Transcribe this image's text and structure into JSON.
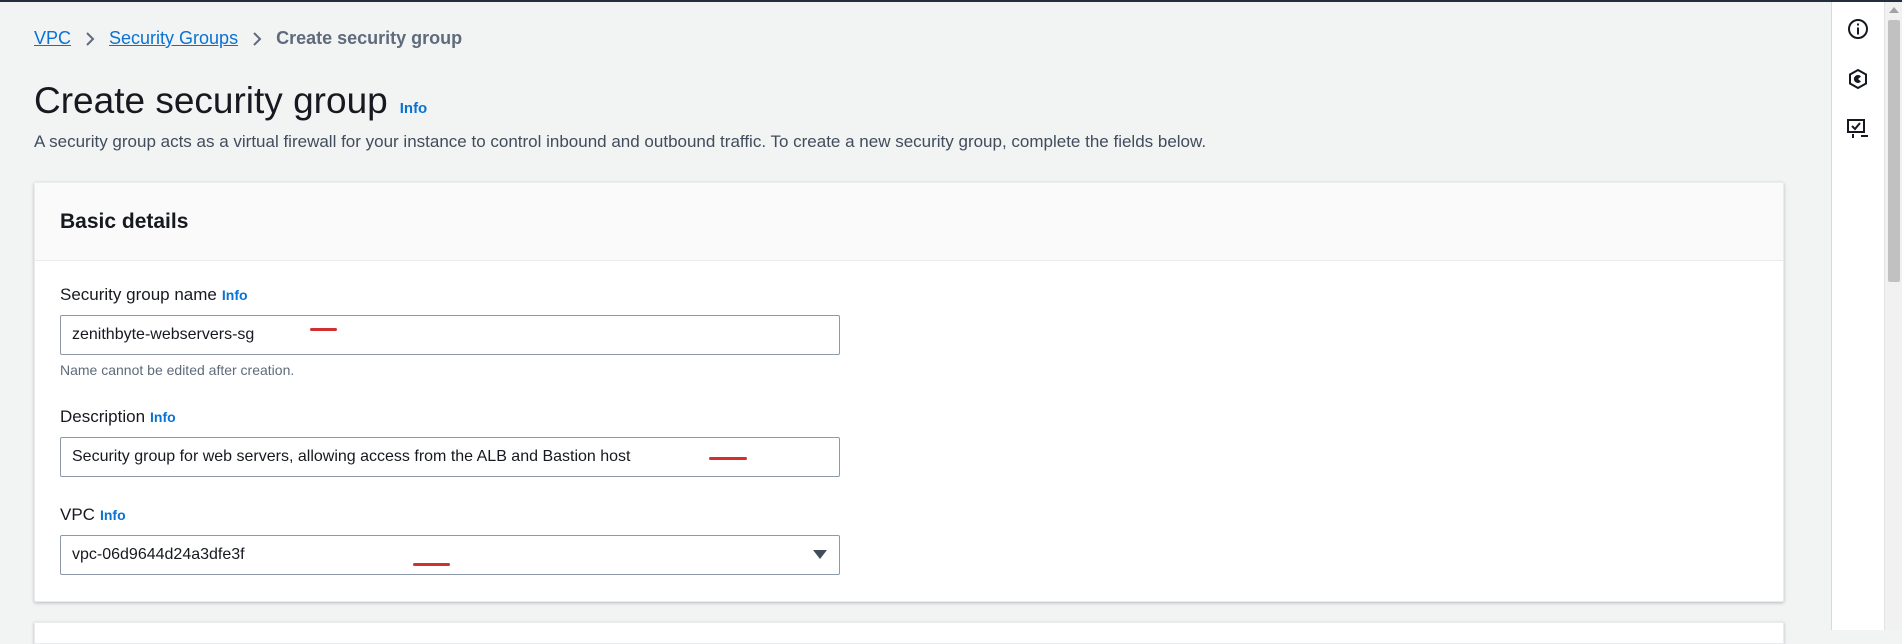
{
  "breadcrumb": {
    "items": [
      {
        "label": "VPC"
      },
      {
        "label": "Security Groups"
      },
      {
        "label": "Create security group"
      }
    ]
  },
  "page": {
    "title": "Create security group",
    "info_label": "Info",
    "description": "A security group acts as a virtual firewall for your instance to control inbound and outbound traffic. To create a new security group, complete the fields below."
  },
  "basic_details": {
    "heading": "Basic details",
    "name_field": {
      "label": "Security group name",
      "info": "Info",
      "value": "zenithbyte-webservers-sg",
      "constraint": "Name cannot be edited after creation."
    },
    "description_field": {
      "label": "Description",
      "info": "Info",
      "value": "Security group for web servers, allowing access from the ALB and Bastion host"
    },
    "vpc_field": {
      "label": "VPC",
      "info": "Info",
      "value": "vpc-06d9644d24a3dfe3f"
    }
  },
  "right_rail": {
    "icons": [
      "info-circle-icon",
      "security-shield-icon",
      "feedback-monitor-icon"
    ]
  },
  "colors": {
    "link": "#0972d3",
    "annotation_mark": "#d32f2f",
    "top_bar": "#232f3e",
    "background": "#f2f3f3"
  }
}
